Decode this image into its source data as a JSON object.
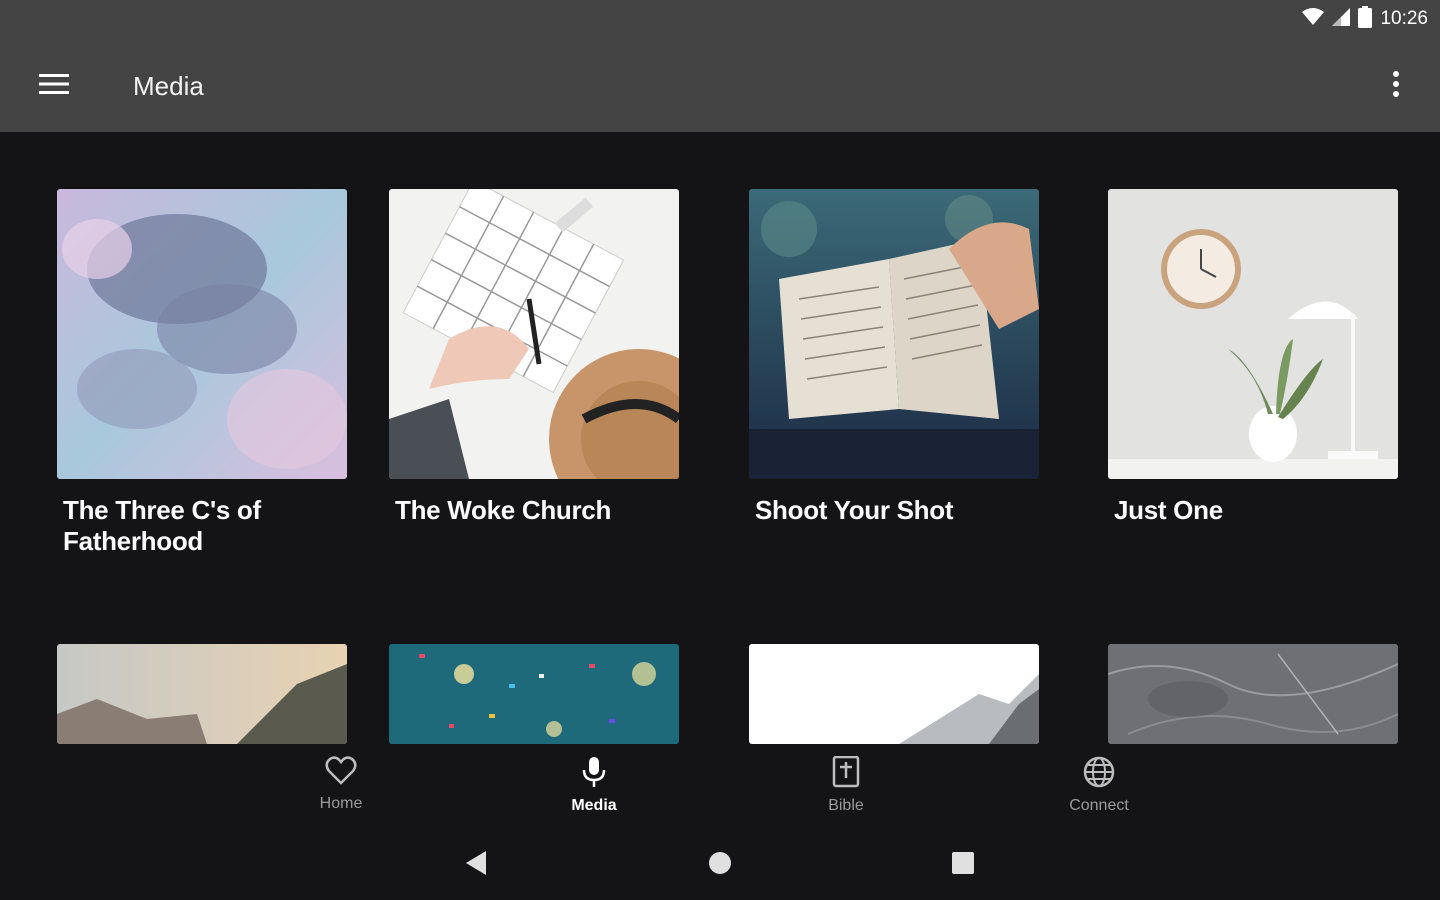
{
  "status_bar": {
    "time": "10:26",
    "icons": [
      "wifi-icon",
      "signal-icon",
      "battery-icon"
    ]
  },
  "app_bar": {
    "title": "Media",
    "menu_icon": "hamburger-menu-icon",
    "overflow_icon": "more-vert-icon"
  },
  "media_items": [
    {
      "title": "The Three C's of Fatherhood",
      "image": "pastel-clouds"
    },
    {
      "title": "The Woke Church",
      "image": "planner-and-hat"
    },
    {
      "title": "Shoot Your Shot",
      "image": "open-bible"
    },
    {
      "title": "Just One",
      "image": "clock-and-plant"
    },
    {
      "title": "",
      "image": "mountain-sky"
    },
    {
      "title": "",
      "image": "confetti-teal"
    },
    {
      "title": "",
      "image": "snowy-mountain"
    },
    {
      "title": "",
      "image": "grey-marble"
    }
  ],
  "bottom_nav": [
    {
      "label": "Home",
      "icon": "heart-icon",
      "active": false
    },
    {
      "label": "Media",
      "icon": "microphone-icon",
      "active": true
    },
    {
      "label": "Bible",
      "icon": "bible-icon",
      "active": false
    },
    {
      "label": "Connect",
      "icon": "globe-icon",
      "active": false
    }
  ],
  "system_nav": [
    "back-icon",
    "home-circle-icon",
    "recents-square-icon"
  ],
  "colors": {
    "app_bar": "#444444",
    "background": "#141416",
    "active_nav": "#ffffff",
    "inactive_nav": "#9a9a9a"
  }
}
